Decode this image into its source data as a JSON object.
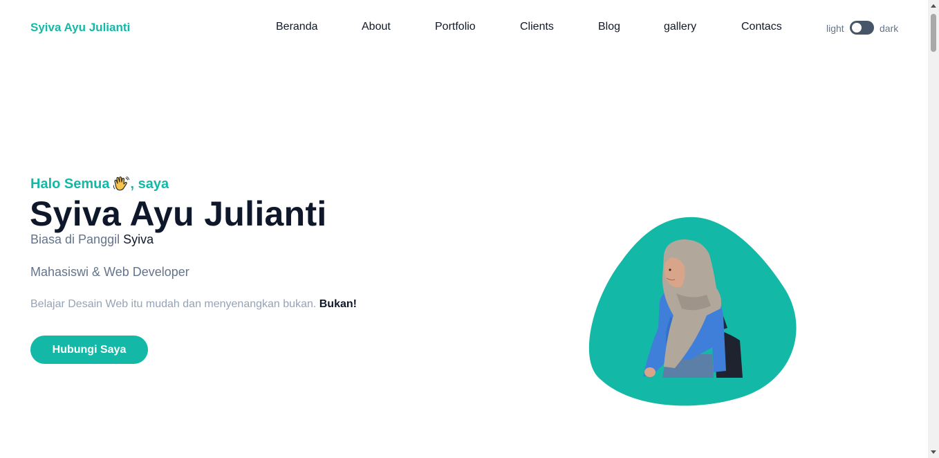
{
  "header": {
    "brand": "Syiva Ayu Julianti",
    "nav": [
      "Beranda",
      "About",
      "Portfolio",
      "Clients",
      "Blog",
      "gallery",
      "Contacs"
    ],
    "theme_toggle": {
      "light_label": "light",
      "dark_label": "dark"
    }
  },
  "hero": {
    "greeting_prefix": "Halo Semua",
    "greeting_icon": "waving-hand-icon",
    "greeting_suffix": ", saya",
    "name": "Syiva Ayu Julianti",
    "nickname_prefix": "Biasa di Panggil ",
    "nickname": "Syiva",
    "role": "Mahasiswi & Web Developer",
    "tagline": "Belajar Desain Web itu mudah dan menyenangkan bukan. ",
    "tagline_emphasis": "Bukan!",
    "cta_label": "Hubungi Saya"
  },
  "colors": {
    "accent": "#14b8a6",
    "heading": "#0f172a",
    "muted": "#64748b",
    "light_muted": "#94a3b8",
    "toggle_track": "#475569"
  }
}
